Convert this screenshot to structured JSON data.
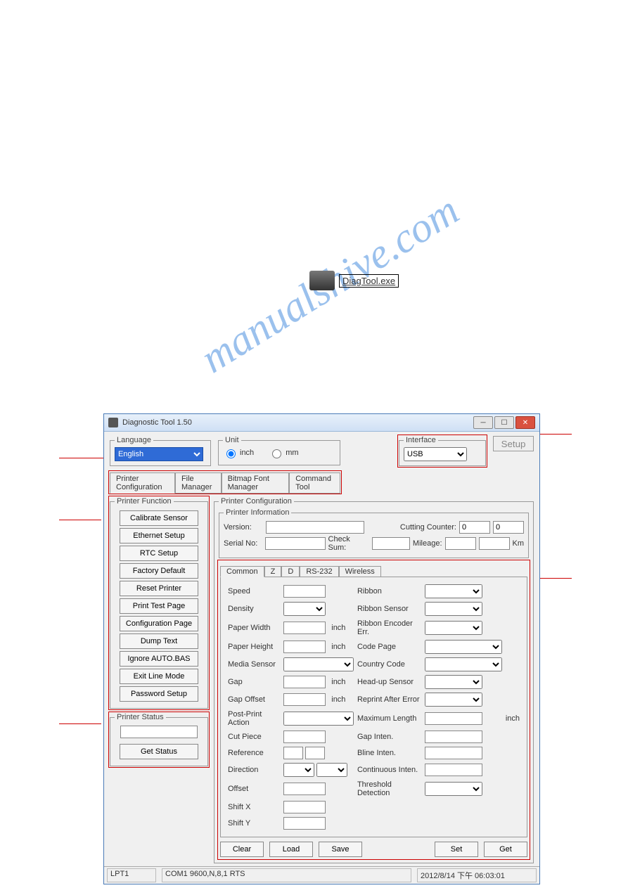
{
  "window_title": "Diagnostic Tool 1.50",
  "language": {
    "legend": "Language",
    "value": "English"
  },
  "unit": {
    "legend": "Unit",
    "inch": "inch",
    "mm": "mm"
  },
  "interface": {
    "legend": "Interface",
    "value": "USB",
    "setup": "Setup"
  },
  "main_tabs": [
    "Printer Configuration",
    "File Manager",
    "Bitmap Font Manager",
    "Command Tool"
  ],
  "printer_function": {
    "legend": "Printer Function",
    "buttons": [
      "Calibrate Sensor",
      "Ethernet Setup",
      "RTC Setup",
      "Factory Default",
      "Reset Printer",
      "Print Test Page",
      "Configuration Page",
      "Dump Text",
      "Ignore AUTO.BAS",
      "Exit Line Mode",
      "Password Setup"
    ]
  },
  "printer_status": {
    "legend": "Printer Status",
    "get": "Get Status"
  },
  "printer_config": {
    "legend": "Printer Configuration",
    "info_legend": "Printer Information",
    "version": "Version:",
    "serial": "Serial No:",
    "checksum": "Check Sum:",
    "cutting": "Cutting Counter:",
    "cutting_v1": "0",
    "cutting_v2": "0",
    "mileage": "Mileage:",
    "km": "Km",
    "sub_tabs": [
      "Common",
      "Z",
      "D",
      "RS-232",
      "Wireless"
    ],
    "left_labels": [
      "Speed",
      "Density",
      "Paper Width",
      "Paper Height",
      "Media Sensor",
      "Gap",
      "Gap Offset",
      "Post-Print Action",
      "Cut Piece",
      "Reference",
      "Direction",
      "Offset",
      "Shift X",
      "Shift Y"
    ],
    "right_labels": [
      "Ribbon",
      "Ribbon Sensor",
      "Ribbon Encoder Err.",
      "Code Page",
      "Country Code",
      "Head-up Sensor",
      "Reprint After Error",
      "Maximum Length",
      "Gap Inten.",
      "Bline Inten.",
      "Continuous Inten.",
      "Threshold Detection"
    ],
    "inch": "inch",
    "buttons": {
      "clear": "Clear",
      "load": "Load",
      "save": "Save",
      "set": "Set",
      "get": "Get"
    }
  },
  "statusbar": {
    "lpt": "LPT1",
    "com": "COM1 9600,N,8,1 RTS",
    "date": "2012/8/14 下午 06:03:01"
  },
  "diag_file": "DiagTool.exe"
}
